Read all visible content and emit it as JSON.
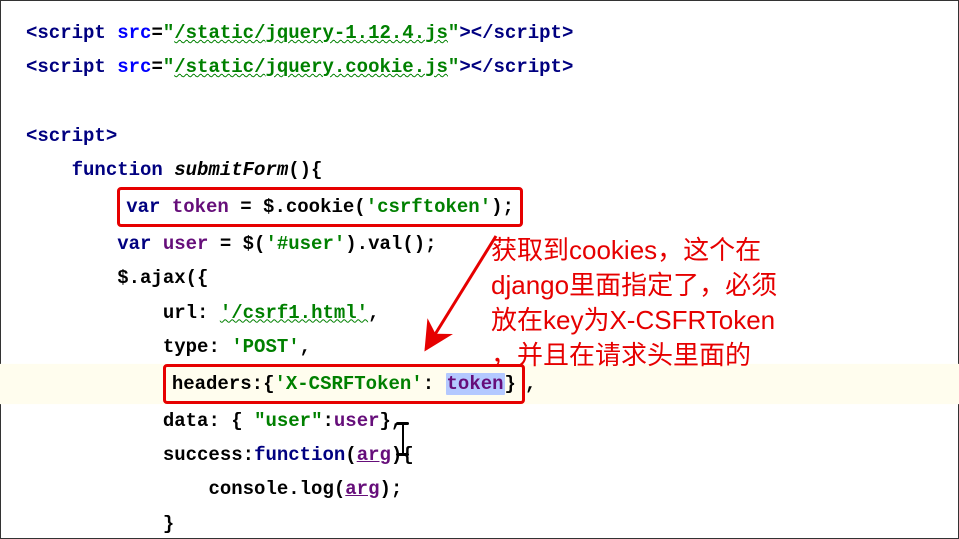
{
  "lines": {
    "l1": {
      "open": "<",
      "tag1": "script",
      "attr": " src",
      "eq": "=",
      "q1": "\"",
      "src": "/static/jquery-1.12.4.js",
      "q2": "\"",
      "close1": ">",
      "open2": "</",
      "tag2": "script",
      "close2": ">"
    },
    "l2": {
      "open": "<",
      "tag1": "script",
      "attr": " src",
      "eq": "=",
      "q1": "\"",
      "src": "/static/jquery.cookie.js",
      "q2": "\"",
      "close1": ">",
      "open2": "</",
      "tag2": "script",
      "close2": ">"
    },
    "l4": {
      "open": "<",
      "tag": "script",
      "close": ">"
    },
    "l5": {
      "kw": "function",
      "name": " submitForm",
      "tail": "(){"
    },
    "l6": {
      "kw": "var ",
      "var": "token",
      "mid": " = $.",
      "call": "cookie",
      "p1": "(",
      "str": "'csrftoken'",
      "p2": ");"
    },
    "l7": {
      "kw": "var ",
      "var": "user",
      "mid": " = $(",
      "str": "'#user'",
      "after": ").",
      "call": "val",
      "p2": "();"
    },
    "l8": {
      "pre": "$.",
      "call": "ajax",
      "p": "({"
    },
    "l9": {
      "key": "url",
      "colon": ": ",
      "str": "'/csrf1.html'",
      "c": ","
    },
    "l10": {
      "key": "type",
      "colon": ": ",
      "str": "'POST'",
      "c": ","
    },
    "l11": {
      "key": "headers",
      "colon": ":",
      "b1": "{",
      "str": "'X-CSRFToken'",
      "c1": ": ",
      "var": "token",
      "b2": "}",
      "c": ","
    },
    "l12": {
      "key": "data",
      "colon": ": ",
      "b1": "{ ",
      "str": "\"user\"",
      "c1": ":",
      "var": "user",
      "b2": "}",
      "c": ","
    },
    "l13": {
      "key": "success",
      "colon": ":",
      "kw": "function",
      "p": "(",
      "arg": "arg",
      "p2": "){"
    },
    "l14": {
      "pre": "console.",
      "call": "log",
      "p": "(",
      "arg": "arg",
      "p2": ");"
    },
    "l15": {
      "b": "}"
    }
  },
  "annotation": {
    "a1": "获取到cookies，这个在",
    "a2": "django里面指定了，必须",
    "a3": "放在key为X-CSFRToken",
    "a4": "，并且在请求头里面的"
  }
}
